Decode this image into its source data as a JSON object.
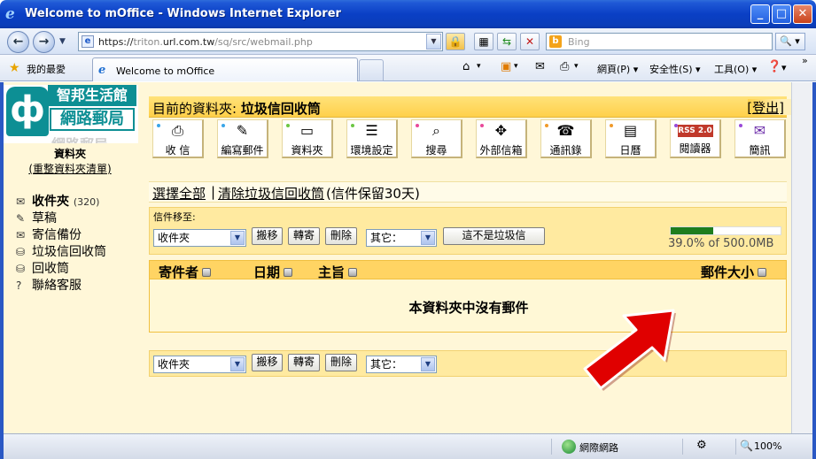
{
  "window": {
    "title": "Welcome to mOffice - Windows Internet Explorer",
    "buttons": {
      "minimize": "_",
      "maximize": "□",
      "close": "✕"
    }
  },
  "navbar": {
    "url_prefix": "https://",
    "url_gray1": "triton.",
    "url_host": "url.com.tw",
    "url_path": "/sq/src/webmail.php",
    "search_placeholder": "Bing",
    "search_go": "🔍 ▾"
  },
  "favbar": {
    "favorites_label": "我的最愛",
    "tab_title": "Welcome to mOffice",
    "commands": {
      "page": "網頁(P) ▾",
      "safety": "安全性(S) ▾",
      "tools": "工具(O) ▾",
      "help": "▾"
    },
    "more": "»"
  },
  "logo": {
    "line1": "智邦生活館",
    "line2": "網路郵局",
    "ghost": "網路郵局"
  },
  "sidebar": {
    "heading": "資料夾",
    "clean_link": "(重整資料夾清單)",
    "folders": [
      {
        "label": "收件夾",
        "count": "(320)",
        "icon": "inbox-icon",
        "glyph": "✉"
      },
      {
        "label": "草稿",
        "icon": "draft-icon",
        "glyph": "✎"
      },
      {
        "label": "寄信備份",
        "icon": "sent-icon",
        "glyph": "✉"
      },
      {
        "label": "垃圾信回收筒",
        "icon": "spam-icon",
        "glyph": "⛁"
      },
      {
        "label": "回收筒",
        "icon": "trash-icon",
        "glyph": "⛁"
      },
      {
        "label": "聯絡客服",
        "icon": "help-icon",
        "glyph": "?"
      }
    ]
  },
  "header": {
    "label": "目前的資料夾:",
    "folder": "垃圾信回收筒",
    "logout": "[登出]"
  },
  "toolbar": [
    {
      "label": "收 信",
      "icon": "receive-mail-icon",
      "glyph": "📥",
      "dot": "#3aa6e8"
    },
    {
      "label": "編寫郵件",
      "icon": "compose-icon",
      "glyph": "📄",
      "dot": "#3aa6e8"
    },
    {
      "label": "資料夾",
      "icon": "folder-icon",
      "glyph": "📁",
      "dot": "#6cc644"
    },
    {
      "label": "環境設定",
      "icon": "settings-icon",
      "glyph": "☰",
      "dot": "#6cc644"
    },
    {
      "label": "搜尋",
      "icon": "search-icon",
      "glyph": "🔍",
      "dot": "#e84a9a"
    },
    {
      "label": "外部信箱",
      "icon": "external-mail-icon",
      "glyph": "✥",
      "dot": "#e84a9a"
    },
    {
      "label": "通訊錄",
      "icon": "address-book-icon",
      "glyph": "☎",
      "dot": "#f09a2a"
    },
    {
      "label": "日曆",
      "icon": "calendar-icon",
      "glyph": "📅",
      "dot": "#f09a2a"
    },
    {
      "label": "閱讀器",
      "icon": "rss-reader-icon",
      "glyph": "RSS",
      "dot": "#9a4ad8"
    },
    {
      "label": "簡訊",
      "icon": "sms-icon",
      "glyph": "✉",
      "dot": "#9a4ad8"
    }
  ],
  "select_row": {
    "select_all": "選擇全部",
    "sep": "|",
    "clear": "清除垃圾信回收筒",
    "note": "(信件保留30天)"
  },
  "actions": {
    "move_label": "信件移至:",
    "folder_select": "收件夾",
    "move": "搬移",
    "forward": "轉寄",
    "delete": "刪除",
    "other_select": "其它：",
    "not_spam": "這不是垃圾信"
  },
  "quota": {
    "percent": 39.0,
    "text": "39.0% of 500.0MB"
  },
  "table": {
    "headers": {
      "sender": "寄件者",
      "date": "日期",
      "subject": "主旨",
      "size": "郵件大小"
    },
    "empty": "本資料夾中沒有郵件"
  },
  "statusbar": {
    "zone": "網際網路",
    "zoom": "100%"
  },
  "colors": {
    "accent": "#ffd04a",
    "page_bg": "#fff7d8",
    "logo_teal": "#0d8f94",
    "arrow": "#e00000"
  }
}
